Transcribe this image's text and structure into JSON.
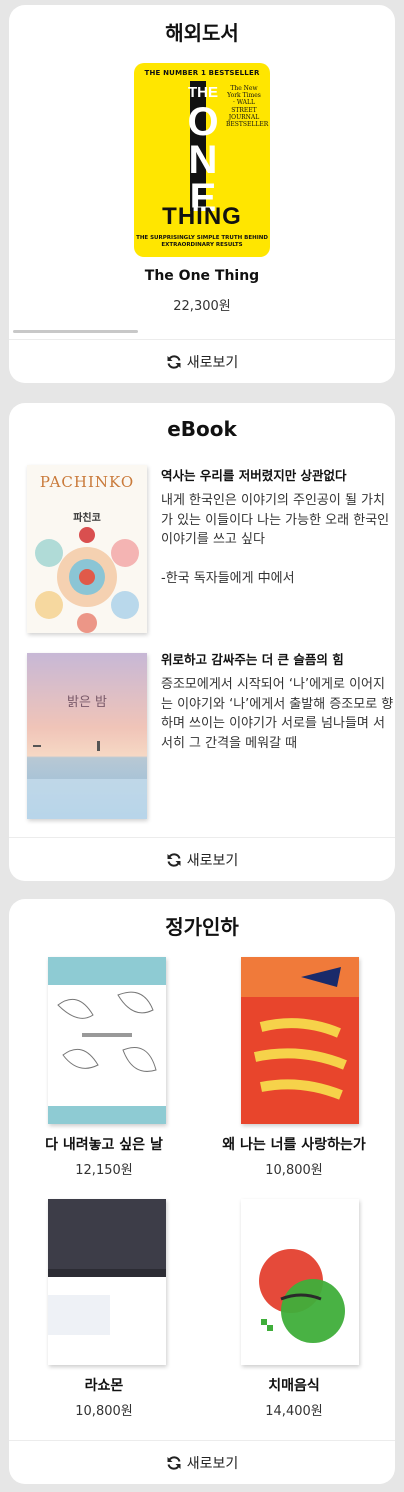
{
  "overseas": {
    "title": "해외도서",
    "book": {
      "name": "The One Thing",
      "price": "22,300원",
      "cover": {
        "top_line": "THE NUMBER 1 BESTSELLER",
        "the": "THE",
        "one": "ONE",
        "thing": "THING",
        "badge": "The New York Times · WALL STREET JOURNAL BESTSELLER",
        "subtitle": "THE SURPRISINGLY SIMPLE TRUTH BEHIND EXTRAORDINARY RESULTS"
      }
    },
    "refresh_label": "새로보기"
  },
  "ebook": {
    "title": "eBook",
    "items": [
      {
        "cover_title": "PACHINKO",
        "cover_korean": "파친코",
        "headline": "역사는 우리를 저버렸지만 상관없다",
        "description": "내게 한국인은 이야기의 주인공이 될 가치가 있는 이들이다 나는 가능한 오래 한국인 이야기를 쓰고 싶다\n\n-한국 독자들에게 中에서"
      },
      {
        "cover_title": "밝은 밤",
        "headline": "위로하고 감싸주는 더 큰 슬픔의 힘",
        "description": "증조모에게서 시작되어 ‘나’에게로 이어지는 이야기와 ‘나’에게서 출발해 증조모로 향하며 쓰이는 이야기가 서로를 넘나들며 서서히 그 간격을 메워갈 때"
      }
    ],
    "refresh_label": "새로보기"
  },
  "discount": {
    "title": "정가인하",
    "books": [
      {
        "name": "다 내려놓고 싶은 날",
        "price": "12,150원"
      },
      {
        "name": "왜 나는 너를 사랑하는가",
        "price": "10,800원"
      },
      {
        "name": "라쇼몬",
        "price": "10,800원"
      },
      {
        "name": "치매음식",
        "price": "14,400원"
      }
    ],
    "refresh_label": "새로보기"
  },
  "colors": {
    "background": "#e6e6e6",
    "card": "#ffffff",
    "one_thing_yellow": "#ffe600"
  },
  "icons": {
    "refresh": "refresh-icon"
  }
}
